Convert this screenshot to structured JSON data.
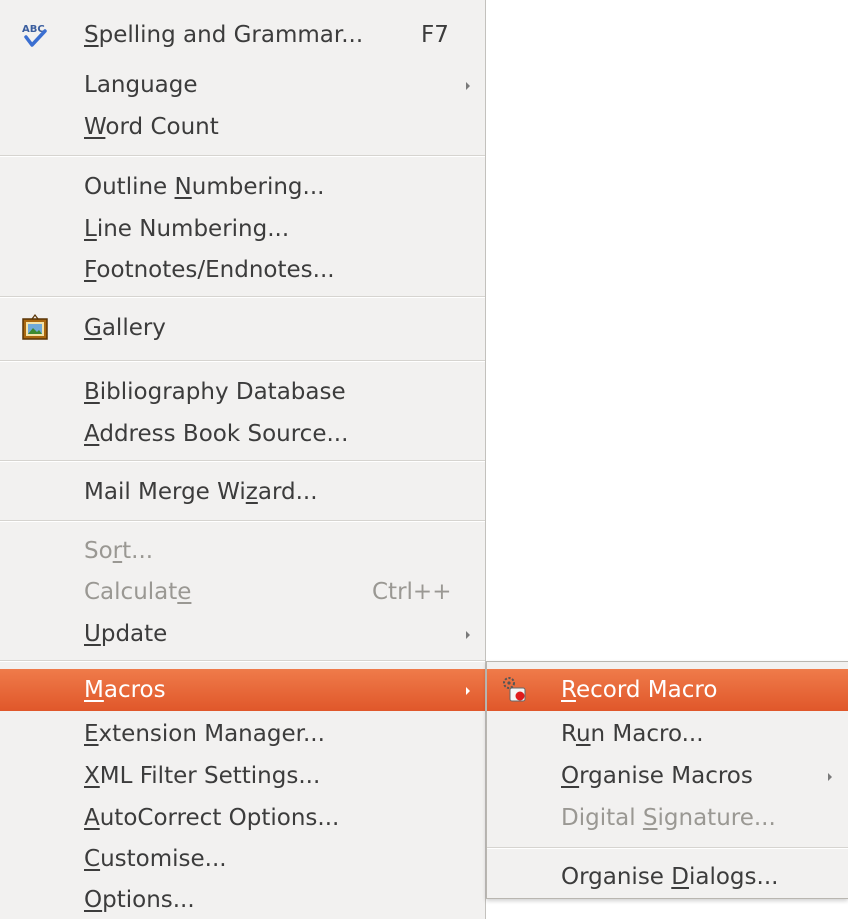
{
  "menu": {
    "spelling": {
      "pre": "",
      "u": "S",
      "post": "pelling and Grammar...",
      "shortcut": "F7",
      "icon": "spellcheck-icon"
    },
    "language": {
      "label": "Language"
    },
    "word_count": {
      "pre": "",
      "u": "W",
      "post": "ord Count"
    },
    "outline_numbering": {
      "pre": "Outline ",
      "u": "N",
      "post": "umbering..."
    },
    "line_numbering": {
      "pre": "",
      "u": "L",
      "post": "ine Numbering..."
    },
    "footnotes": {
      "pre": "",
      "u": "F",
      "post": "ootnotes/Endnotes..."
    },
    "gallery": {
      "pre": "",
      "u": "G",
      "post": "allery",
      "icon": "gallery-icon"
    },
    "bibliography": {
      "pre": "",
      "u": "B",
      "post": "ibliography Database"
    },
    "address_book": {
      "pre": "",
      "u": "A",
      "post": "ddress Book Source..."
    },
    "mail_merge": {
      "pre": "Mail Merge Wi",
      "u": "z",
      "post": "ard..."
    },
    "sort": {
      "pre": "So",
      "u": "r",
      "post": "t..."
    },
    "calculate": {
      "pre": "Calculat",
      "u": "e",
      "post": "",
      "shortcut": "Ctrl++"
    },
    "update": {
      "pre": "",
      "u": "U",
      "post": "pdate"
    },
    "macros": {
      "pre": "",
      "u": "M",
      "post": "acros"
    },
    "extension_manager": {
      "pre": "",
      "u": "E",
      "post": "xtension Manager..."
    },
    "xml_filter": {
      "pre": "",
      "u": "X",
      "post": "ML Filter Settings..."
    },
    "autocorrect": {
      "pre": "",
      "u": "A",
      "post": "utoCorrect Options..."
    },
    "customise": {
      "pre": "",
      "u": "C",
      "post": "ustomise..."
    },
    "options": {
      "pre": "",
      "u": "O",
      "post": "ptions..."
    }
  },
  "submenu": {
    "record_macro": {
      "pre": "",
      "u": "R",
      "post": "ecord Macro",
      "icon": "record-macro-icon"
    },
    "run_macro": {
      "pre": "R",
      "u": "u",
      "post": "n Macro..."
    },
    "organise_macros": {
      "pre": "",
      "u": "O",
      "post": "rganise Macros"
    },
    "digital_signature": {
      "pre": "Digital ",
      "u": "S",
      "post": "ignature..."
    },
    "organise_dialogs": {
      "pre": "Organise ",
      "u": "D",
      "post": "ialogs..."
    }
  },
  "colors": {
    "highlight": "#e65f30",
    "menu_bg": "#f2f1f0",
    "text": "#3c3c3c",
    "disabled_text": "#9a9893"
  }
}
